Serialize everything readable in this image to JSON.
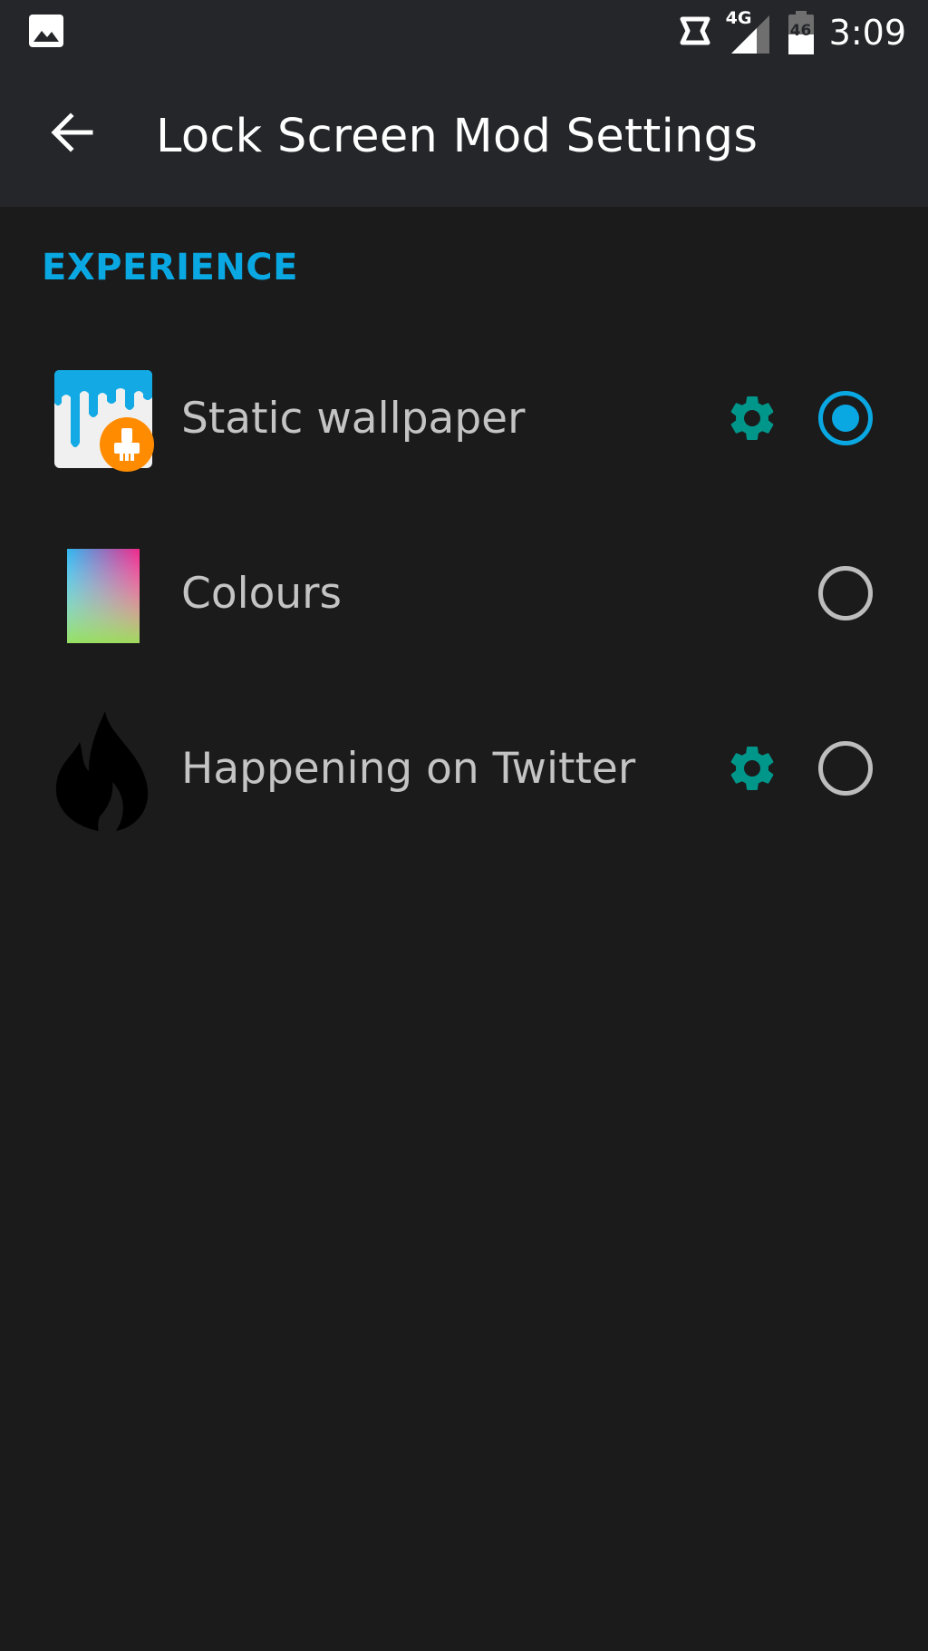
{
  "status_bar": {
    "clock": "3:09",
    "network_type": "4G",
    "battery_level": "46",
    "icons": [
      "gallery-icon",
      "data-saver-icon",
      "signal-icon",
      "battery-icon"
    ]
  },
  "app_bar": {
    "title": "Lock Screen Mod Settings",
    "back_icon": "back-arrow-icon"
  },
  "section": {
    "header": "EXPERIENCE"
  },
  "items": [
    {
      "label": "Static wallpaper",
      "icon": "static-wallpaper-icon",
      "has_settings": true,
      "selected": true
    },
    {
      "label": "Colours",
      "icon": "colours-gradient-icon",
      "has_settings": false,
      "selected": false
    },
    {
      "label": "Happening on Twitter",
      "icon": "flame-icon",
      "has_settings": true,
      "selected": false
    }
  ],
  "colors": {
    "accent": "#0aa8e2",
    "settings_gear": "#00968a",
    "bar_background": "#25262a",
    "background": "#1b1b1b",
    "label_text": "#c4c4c4"
  }
}
